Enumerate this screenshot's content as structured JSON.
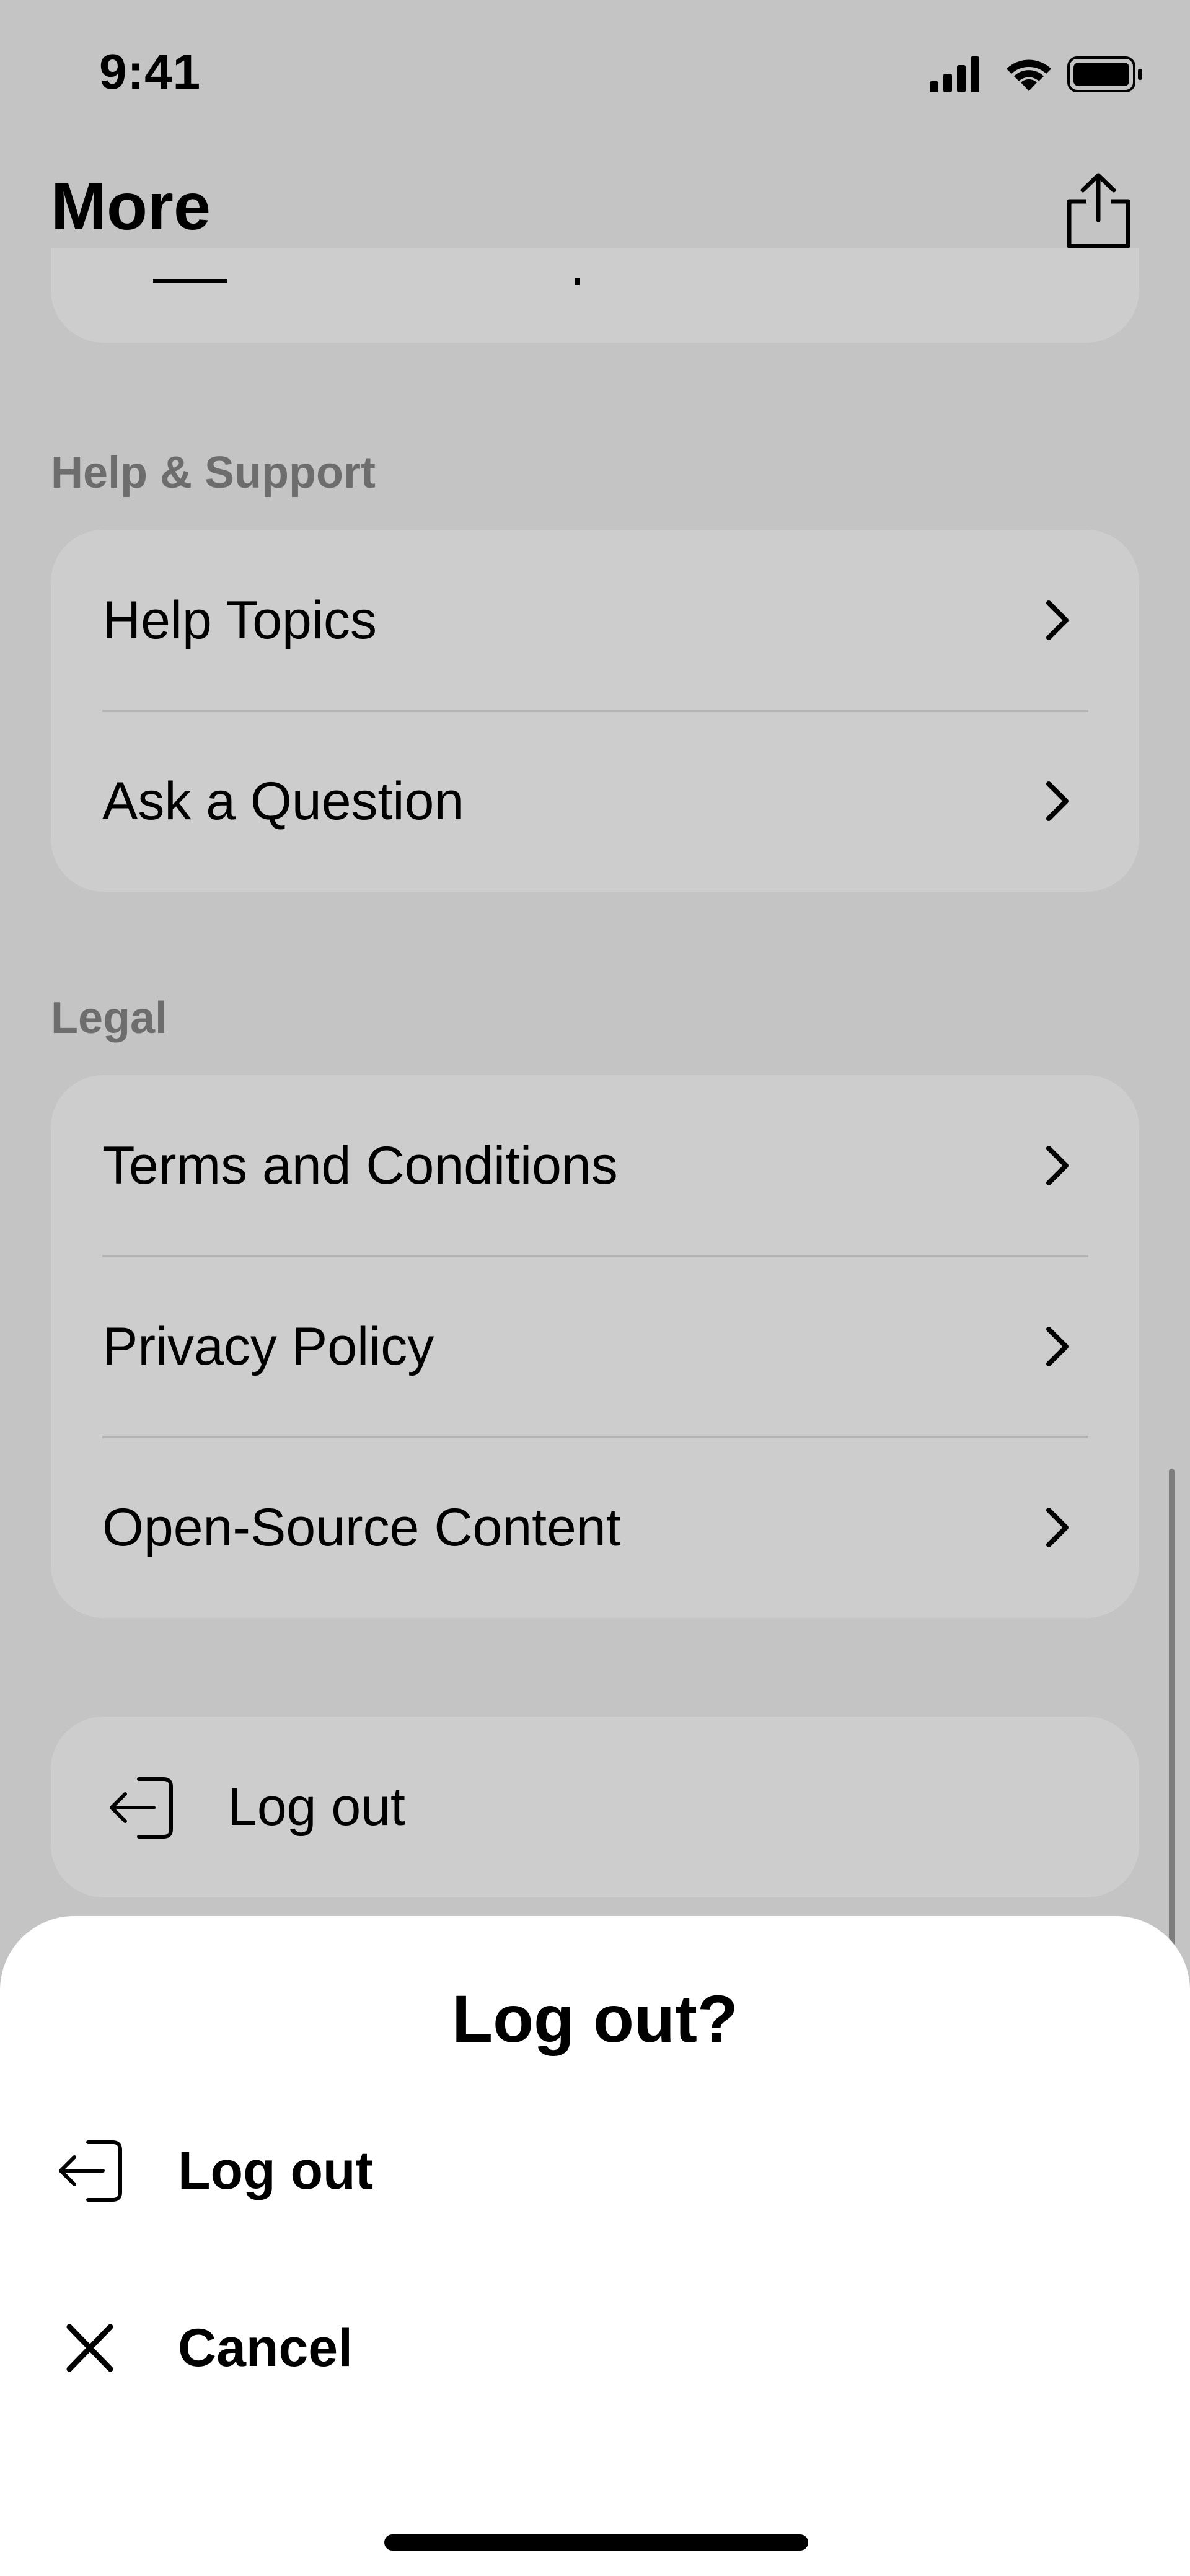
{
  "status_bar": {
    "time": "9:41",
    "icons": [
      "cellular-signal-icon",
      "wifi-icon",
      "battery-icon"
    ]
  },
  "nav": {
    "title": "More",
    "share_icon": "share-icon"
  },
  "sections": [
    {
      "header": "Help & Support",
      "items": [
        {
          "label": "Help Topics",
          "icon": "chevron-right-icon"
        },
        {
          "label": "Ask a Question",
          "icon": "chevron-right-icon"
        }
      ]
    },
    {
      "header": "Legal",
      "items": [
        {
          "label": "Terms and Conditions",
          "icon": "chevron-right-icon"
        },
        {
          "label": "Privacy Policy",
          "icon": "chevron-right-icon"
        },
        {
          "label": "Open-Source Content",
          "icon": "chevron-right-icon"
        }
      ]
    }
  ],
  "logout_card": {
    "label": "Log out",
    "icon": "log-out-icon"
  },
  "sheet": {
    "title": "Log out?",
    "actions": [
      {
        "label": "Log out",
        "icon": "log-out-icon"
      },
      {
        "label": "Cancel",
        "icon": "close-icon"
      }
    ]
  },
  "colors": {
    "dim_background": "#c4c4c4",
    "card": "#cdcdcd",
    "section_header": "#6d6d6d",
    "sheet": "#ffffff"
  }
}
